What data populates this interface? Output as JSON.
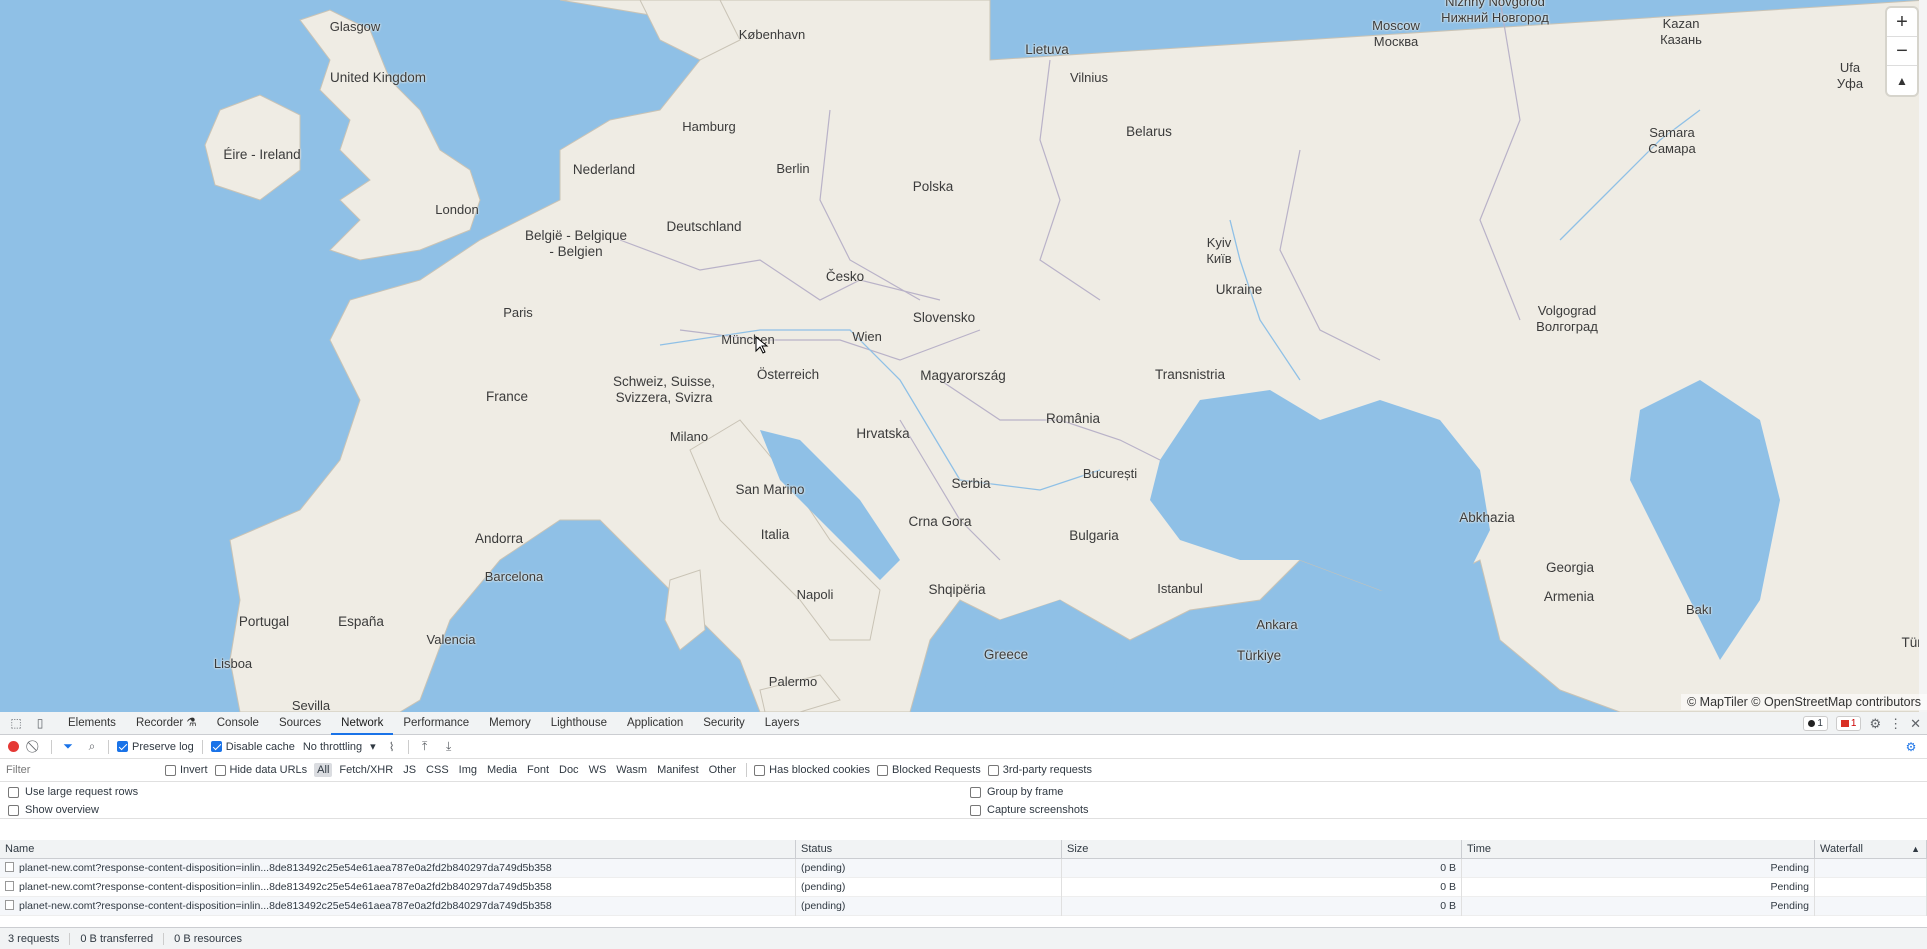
{
  "map": {
    "labels": [
      {
        "text": "Glasgow",
        "kind": "city"
      },
      {
        "text": "United Kingdom",
        "kind": "country"
      },
      {
        "text": "Éire - Ireland",
        "kind": "country"
      },
      {
        "text": "London",
        "kind": "city"
      },
      {
        "text": "København",
        "kind": "city"
      },
      {
        "text": "Hamburg",
        "kind": "city"
      },
      {
        "text": "Nederland",
        "kind": "country"
      },
      {
        "text": "Berlin",
        "kind": "city"
      },
      {
        "text": "België - Belgique\n- Belgien",
        "kind": "country"
      },
      {
        "text": "Deutschland",
        "kind": "country"
      },
      {
        "text": "Paris",
        "kind": "city"
      },
      {
        "text": "France",
        "kind": "country"
      },
      {
        "text": "Česko",
        "kind": "country"
      },
      {
        "text": "München",
        "kind": "city"
      },
      {
        "text": "Schweiz, Suisse,\nSvizzera, Svizra",
        "kind": "country"
      },
      {
        "text": "Österreich",
        "kind": "country"
      },
      {
        "text": "Wien",
        "kind": "city"
      },
      {
        "text": "Slovensko",
        "kind": "country"
      },
      {
        "text": "Milano",
        "kind": "city"
      },
      {
        "text": "Magyarország",
        "kind": "country"
      },
      {
        "text": "Hrvatska",
        "kind": "country"
      },
      {
        "text": "Andorra",
        "kind": "country"
      },
      {
        "text": "Barcelona",
        "kind": "city"
      },
      {
        "text": "San Marino",
        "kind": "country"
      },
      {
        "text": "Italia",
        "kind": "country"
      },
      {
        "text": "Portugal",
        "kind": "country"
      },
      {
        "text": "España",
        "kind": "country"
      },
      {
        "text": "Valencia",
        "kind": "city"
      },
      {
        "text": "Lisboa",
        "kind": "city"
      },
      {
        "text": "Sevilla",
        "kind": "city"
      },
      {
        "text": "Napoli",
        "kind": "city"
      },
      {
        "text": "Palermo",
        "kind": "city"
      },
      {
        "text": "Serbia",
        "kind": "country"
      },
      {
        "text": "Crna Gora",
        "kind": "country"
      },
      {
        "text": "Shqipëria",
        "kind": "country"
      },
      {
        "text": "Greece",
        "kind": "country"
      },
      {
        "text": "Bulgaria",
        "kind": "country"
      },
      {
        "text": "România",
        "kind": "country"
      },
      {
        "text": "București",
        "kind": "city"
      },
      {
        "text": "Istanbul",
        "kind": "city"
      },
      {
        "text": "Ankara",
        "kind": "city"
      },
      {
        "text": "Türkiye",
        "kind": "country"
      },
      {
        "text": "Transnistria",
        "kind": "country"
      },
      {
        "text": "Polska",
        "kind": "country"
      },
      {
        "text": "Lietuva",
        "kind": "country"
      },
      {
        "text": "Vilnius",
        "kind": "city"
      },
      {
        "text": "Belarus",
        "kind": "country"
      },
      {
        "text": "Kyiv\nКиїв",
        "kind": "city"
      },
      {
        "text": "Ukraine",
        "kind": "country"
      },
      {
        "text": "Moscow\nМосква",
        "kind": "city"
      },
      {
        "text": "Nizhny Novgorod\nНижний Новгород",
        "kind": "city"
      },
      {
        "text": "Kazan\nКазань",
        "kind": "city"
      },
      {
        "text": "Ufa\nУфа",
        "kind": "city"
      },
      {
        "text": "Samara\nСамара",
        "kind": "city"
      },
      {
        "text": "Volgograd\nВолгоград",
        "kind": "city"
      },
      {
        "text": "Abkhazia",
        "kind": "country"
      },
      {
        "text": "Georgia",
        "kind": "country"
      },
      {
        "text": "Armenia",
        "kind": "country"
      },
      {
        "text": "Bakı",
        "kind": "city"
      },
      {
        "text": "Türk",
        "kind": "country"
      }
    ],
    "attribution": "© MapTiler © OpenStreetMap contributors",
    "zoom_in": "+",
    "zoom_out": "−",
    "compass": "▲",
    "colors": {
      "water": "#8fc0e6",
      "land": "#efece4",
      "border": "#b9b2c8"
    }
  },
  "devtools": {
    "tabs": [
      "Elements",
      "Recorder ⚗",
      "Console",
      "Sources",
      "Network",
      "Performance",
      "Memory",
      "Lighthouse",
      "Application",
      "Security",
      "Layers"
    ],
    "active_tab": "Network",
    "badges": {
      "warnings": "1",
      "errors": "1"
    },
    "toolbar": {
      "preserve_log": "Preserve log",
      "disable_cache": "Disable cache",
      "throttling": "No throttling"
    },
    "filter": {
      "placeholder": "Filter",
      "invert": "Invert",
      "hide_data_urls": "Hide data URLs",
      "types": [
        "All",
        "Fetch/XHR",
        "JS",
        "CSS",
        "Img",
        "Media",
        "Font",
        "Doc",
        "WS",
        "Wasm",
        "Manifest",
        "Other"
      ],
      "active_type": "All",
      "has_blocked_cookies": "Has blocked cookies",
      "blocked_requests": "Blocked Requests",
      "third_party": "3rd-party requests"
    },
    "options": {
      "large_rows": "Use large request rows",
      "show_overview": "Show overview",
      "group_by_frame": "Group by frame",
      "capture_screenshots": "Capture screenshots"
    },
    "table": {
      "headers": {
        "name": "Name",
        "status": "Status",
        "size": "Size",
        "time": "Time",
        "waterfall": "Waterfall"
      },
      "rows": [
        {
          "name": "planet-new.comt?response-content-disposition=inlin...8de813492c25e54e61aea787e0a2fd2b840297da749d5b358",
          "status": "(pending)",
          "size": "0 B",
          "time": "Pending"
        },
        {
          "name": "planet-new.comt?response-content-disposition=inlin...8de813492c25e54e61aea787e0a2fd2b840297da749d5b358",
          "status": "(pending)",
          "size": "0 B",
          "time": "Pending"
        },
        {
          "name": "planet-new.comt?response-content-disposition=inlin...8de813492c25e54e61aea787e0a2fd2b840297da749d5b358",
          "status": "(pending)",
          "size": "0 B",
          "time": "Pending"
        }
      ]
    },
    "status_bar": {
      "requests": "3 requests",
      "transferred": "0 B transferred",
      "resources": "0 B resources"
    }
  }
}
